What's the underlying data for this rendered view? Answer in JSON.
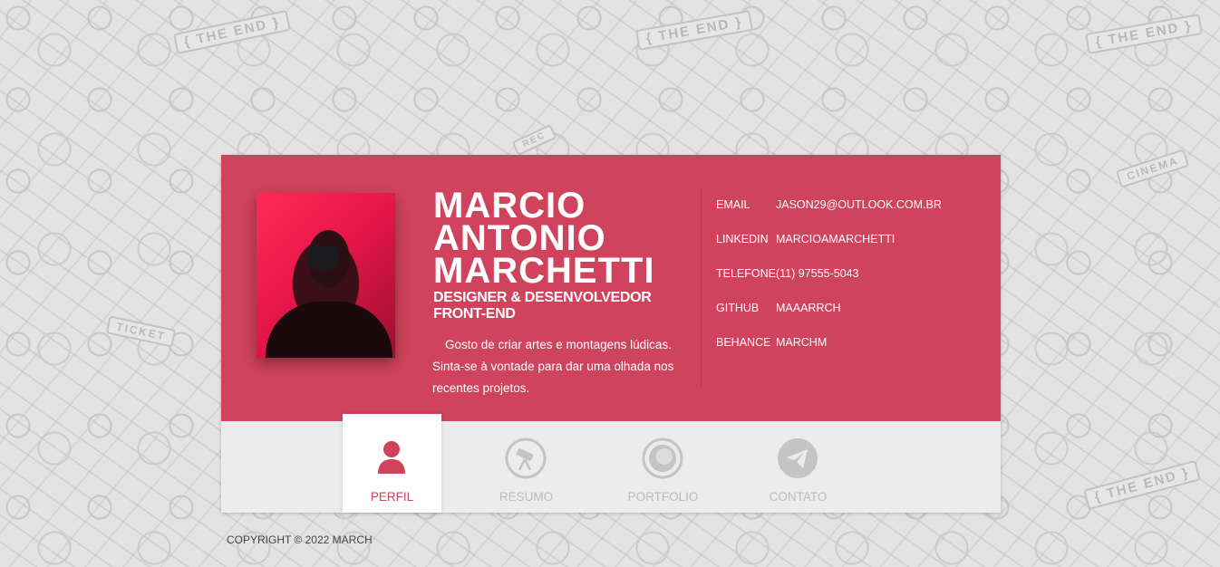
{
  "background": {
    "doodle_labels": [
      "{ THE END }",
      "{ THE END }",
      "{ THE END }",
      "{ THE END }",
      "CINEMA",
      "TICKET",
      "REC"
    ]
  },
  "profile": {
    "name": "MARCIO ANTONIO MARCHETTI",
    "role": "DESIGNER & DESENVOLVEDOR FRONT-END",
    "bio": "Gosto de criar artes e montagens lúdicas. Sinta-se à vontade para dar uma olhada nos recentes projetos.",
    "accent_color": "#d0435c"
  },
  "contacts": [
    {
      "label": "EMAIL",
      "value": "JASON29@OUTLOOK.COM.BR"
    },
    {
      "label": "LINKEDIN",
      "value": "MARCIOAMARCHETTI"
    },
    {
      "label": "TELEFONE",
      "value": "(11) 97555-5043"
    },
    {
      "label": "GITHUB",
      "value": "MAAARRCH"
    },
    {
      "label": "BEHANCE",
      "value": "MARCHM"
    }
  ],
  "nav": [
    {
      "label": "PERFIL",
      "icon": "user-icon",
      "active": true
    },
    {
      "label": "RESUMO",
      "icon": "telescope-icon",
      "active": false
    },
    {
      "label": "PORTFOLIO",
      "icon": "lens-icon",
      "active": false
    },
    {
      "label": "CONTATO",
      "icon": "paper-plane-icon",
      "active": false
    }
  ],
  "footer": {
    "copyright": "COPYRIGHT © 2022 MARCH"
  }
}
